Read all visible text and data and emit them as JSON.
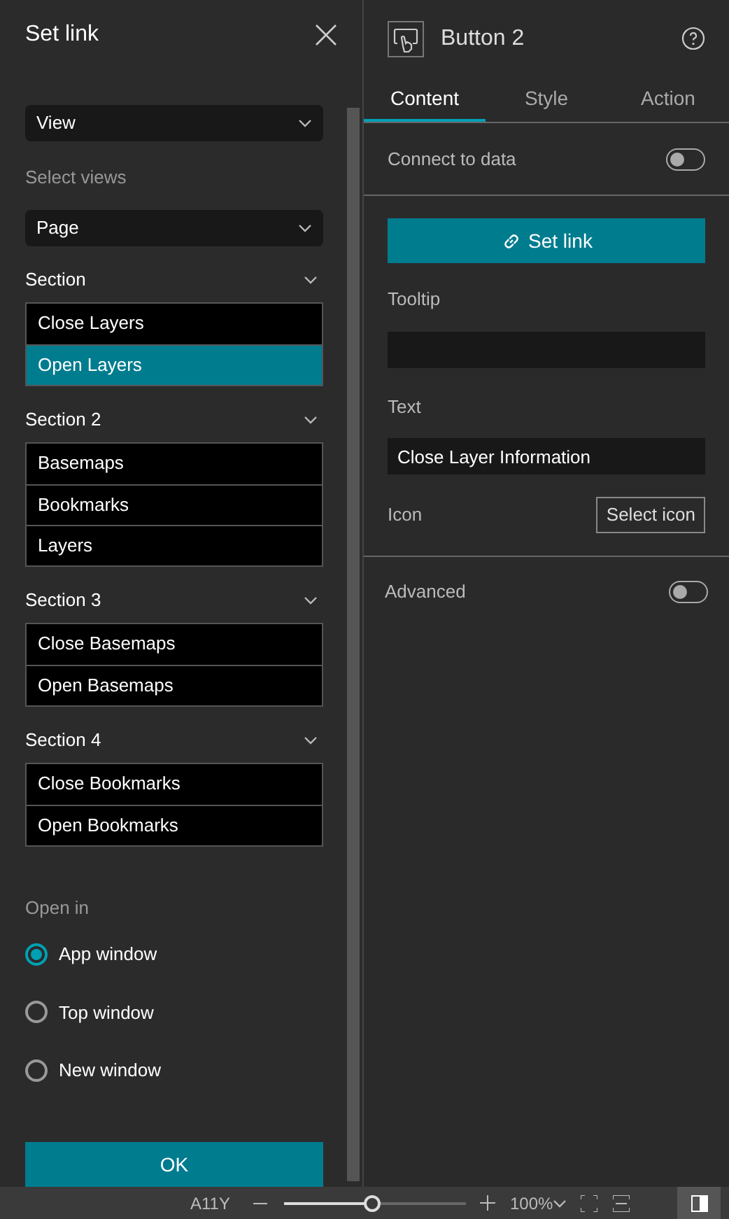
{
  "dialog": {
    "title": "Set link",
    "link_to": {
      "value": "View"
    },
    "select_views": {
      "label": "Select views",
      "value": "Page"
    },
    "sections": [
      {
        "title": "Section",
        "expanded": true,
        "items": [
          {
            "label": "Close Layers",
            "selected": false
          },
          {
            "label": "Open Layers",
            "selected": true
          }
        ]
      },
      {
        "title": "Section 2",
        "expanded": true,
        "items": [
          {
            "label": "Basemaps",
            "selected": false
          },
          {
            "label": "Bookmarks",
            "selected": false
          },
          {
            "label": "Layers",
            "selected": false
          }
        ]
      },
      {
        "title": "Section 3",
        "expanded": true,
        "items": [
          {
            "label": "Close Basemaps",
            "selected": false
          },
          {
            "label": "Open Basemaps",
            "selected": false
          }
        ]
      },
      {
        "title": "Section 4",
        "expanded": true,
        "items": [
          {
            "label": "Close Bookmarks",
            "selected": false
          },
          {
            "label": "Open Bookmarks",
            "selected": false
          }
        ]
      }
    ],
    "open_in": {
      "label": "Open in",
      "options": [
        {
          "label": "App window",
          "selected": true
        },
        {
          "label": "Top window",
          "selected": false
        },
        {
          "label": "New window",
          "selected": false
        }
      ]
    },
    "ok_button": "OK"
  },
  "panel": {
    "title": "Button 2",
    "tabs": [
      {
        "label": "Content",
        "selected": true
      },
      {
        "label": "Style",
        "selected": false
      },
      {
        "label": "Action",
        "selected": false
      }
    ],
    "connect_to_data": {
      "label": "Connect to data",
      "on": false
    },
    "set_link_button": "Set link",
    "tooltip": {
      "label": "Tooltip"
    },
    "text": {
      "label": "Text",
      "value": "Close Layer Information"
    },
    "icon": {
      "label": "Icon",
      "button": "Select icon"
    },
    "advanced": {
      "label": "Advanced",
      "on": false
    }
  },
  "status_bar": {
    "a11y": "A11Y",
    "zoom": {
      "level": 0.48,
      "value": "100%"
    }
  }
}
